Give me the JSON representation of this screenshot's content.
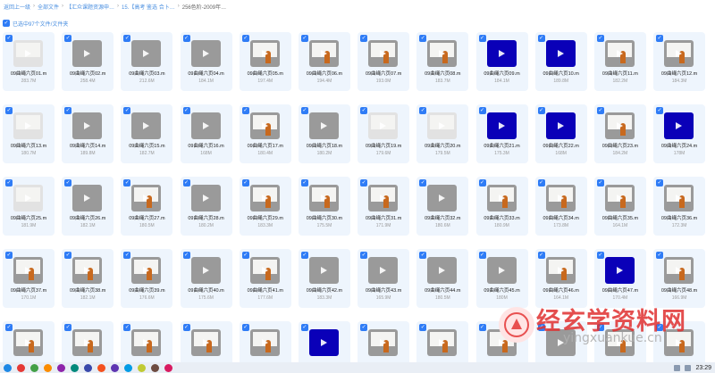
{
  "breadcrumb": {
    "items": [
      "返回上一级",
      "全部文件",
      "【汇众课题资源申…",
      "15.【高考 鉴选 合卜…",
      "256色阶-2009年…"
    ]
  },
  "selection": {
    "label": "已选中97个文件/文件夹"
  },
  "files": [
    {
      "name": "09曲绳六页01.m",
      "size": "283.7M",
      "thumb": "light"
    },
    {
      "name": "09曲绳六页02.m",
      "size": "258.4M",
      "thumb": "gray"
    },
    {
      "name": "09曲绳六页03.m",
      "size": "212.6M",
      "thumb": "gray"
    },
    {
      "name": "09曲绳六页04.m",
      "size": "184.1M",
      "thumb": "gray"
    },
    {
      "name": "09曲绳六页05.m",
      "size": "197.4M",
      "thumb": "board"
    },
    {
      "name": "09曲绳六页06.m",
      "size": "194.4M",
      "thumb": "board"
    },
    {
      "name": "09曲绳六页07.m",
      "size": "193.0M",
      "thumb": "board"
    },
    {
      "name": "09曲绳六页08.m",
      "size": "183.7M",
      "thumb": "board"
    },
    {
      "name": "09曲绳六页09.m",
      "size": "184.1M",
      "thumb": "blue"
    },
    {
      "name": "09曲绳六页10.m",
      "size": "189.8M",
      "thumb": "blue"
    },
    {
      "name": "09曲绳六页11.m",
      "size": "182.2M",
      "thumb": "board"
    },
    {
      "name": "09曲绳六页12.m",
      "size": "184.3M",
      "thumb": "board"
    },
    {
      "name": "09曲绳六页13.m",
      "size": "180.7M",
      "thumb": "light"
    },
    {
      "name": "09曲绳六页14.m",
      "size": "189.8M",
      "thumb": "gray"
    },
    {
      "name": "09曲绳六页15.m",
      "size": "182.7M",
      "thumb": "gray"
    },
    {
      "name": "09曲绳六页16.m",
      "size": "168M",
      "thumb": "gray"
    },
    {
      "name": "09曲绳六页17.m",
      "size": "180.4M",
      "thumb": "board"
    },
    {
      "name": "09曲绳六页18.m",
      "size": "180.2M",
      "thumb": "gray"
    },
    {
      "name": "09曲绳六页19.m",
      "size": "179.6M",
      "thumb": "light"
    },
    {
      "name": "09曲绳六页20.m",
      "size": "179.5M",
      "thumb": "light"
    },
    {
      "name": "09曲绳六页21.m",
      "size": "175.3M",
      "thumb": "blue"
    },
    {
      "name": "09曲绳六页22.m",
      "size": "168M",
      "thumb": "blue"
    },
    {
      "name": "09曲绳六页23.m",
      "size": "184.2M",
      "thumb": "board"
    },
    {
      "name": "09曲绳六页24.m",
      "size": "178M",
      "thumb": "blue"
    },
    {
      "name": "09曲绳六页25.m",
      "size": "181.9M",
      "thumb": "light"
    },
    {
      "name": "09曲绳六页26.m",
      "size": "182.1M",
      "thumb": "gray"
    },
    {
      "name": "09曲绳六页27.m",
      "size": "180.5M",
      "thumb": "board"
    },
    {
      "name": "09曲绳六页28.m",
      "size": "180.2M",
      "thumb": "gray"
    },
    {
      "name": "09曲绳六页29.m",
      "size": "183.3M",
      "thumb": "board"
    },
    {
      "name": "09曲绳六页30.m",
      "size": "175.5M",
      "thumb": "board"
    },
    {
      "name": "09曲绳六页31.m",
      "size": "171.9M",
      "thumb": "board"
    },
    {
      "name": "09曲绳六页32.m",
      "size": "180.6M",
      "thumb": "gray"
    },
    {
      "name": "09曲绳六页33.m",
      "size": "180.9M",
      "thumb": "board"
    },
    {
      "name": "09曲绳六页34.m",
      "size": "173.8M",
      "thumb": "board"
    },
    {
      "name": "09曲绳六页35.m",
      "size": "164.1M",
      "thumb": "board"
    },
    {
      "name": "09曲绳六页36.m",
      "size": "172.3M",
      "thumb": "board"
    },
    {
      "name": "09曲绳六页37.m",
      "size": "170.1M",
      "thumb": "board"
    },
    {
      "name": "09曲绳六页38.m",
      "size": "182.1M",
      "thumb": "board"
    },
    {
      "name": "09曲绳六页39.m",
      "size": "176.6M",
      "thumb": "board"
    },
    {
      "name": "09曲绳六页40.m",
      "size": "175.6M",
      "thumb": "gray"
    },
    {
      "name": "09曲绳六页41.m",
      "size": "177.6M",
      "thumb": "board"
    },
    {
      "name": "09曲绳六页42.m",
      "size": "183.3M",
      "thumb": "gray"
    },
    {
      "name": "09曲绳六页43.m",
      "size": "165.9M",
      "thumb": "gray"
    },
    {
      "name": "09曲绳六页44.m",
      "size": "180.5M",
      "thumb": "gray"
    },
    {
      "name": "09曲绳六页45.m",
      "size": "180M",
      "thumb": "gray"
    },
    {
      "name": "09曲绳六页46.m",
      "size": "164.1M",
      "thumb": "board"
    },
    {
      "name": "09曲绳六页47.m",
      "size": "170.4M",
      "thumb": "blue"
    },
    {
      "name": "09曲绳六页48.m",
      "size": "166.9M",
      "thumb": "board"
    },
    {
      "name": "",
      "size": "",
      "thumb": "board"
    },
    {
      "name": "",
      "size": "",
      "thumb": "board"
    },
    {
      "name": "",
      "size": "",
      "thumb": "board"
    },
    {
      "name": "",
      "size": "",
      "thumb": "board"
    },
    {
      "name": "",
      "size": "",
      "thumb": "board"
    },
    {
      "name": "",
      "size": "",
      "thumb": "blue"
    },
    {
      "name": "",
      "size": "",
      "thumb": "board"
    },
    {
      "name": "",
      "size": "",
      "thumb": "board"
    },
    {
      "name": "",
      "size": "",
      "thumb": "board"
    },
    {
      "name": "",
      "size": "",
      "thumb": "gray"
    },
    {
      "name": "",
      "size": "",
      "thumb": "board"
    },
    {
      "name": "",
      "size": "",
      "thumb": "board"
    }
  ],
  "watermark": {
    "title": "经玄学资料网",
    "url": "yingxuankue.cn"
  },
  "taskbar": {
    "time": "23:29",
    "icon_colors": [
      "#1e88e5",
      "#e53935",
      "#43a047",
      "#fb8c00",
      "#8e24aa",
      "#00897b",
      "#3949ab",
      "#f4511e",
      "#5e35b1",
      "#039be5",
      "#c0ca33",
      "#6d4c41",
      "#d81b60"
    ]
  },
  "colors": {
    "accent": "#2f7cf6",
    "tile_bg": "#eef5fd",
    "video_blue": "#0a00b8"
  }
}
